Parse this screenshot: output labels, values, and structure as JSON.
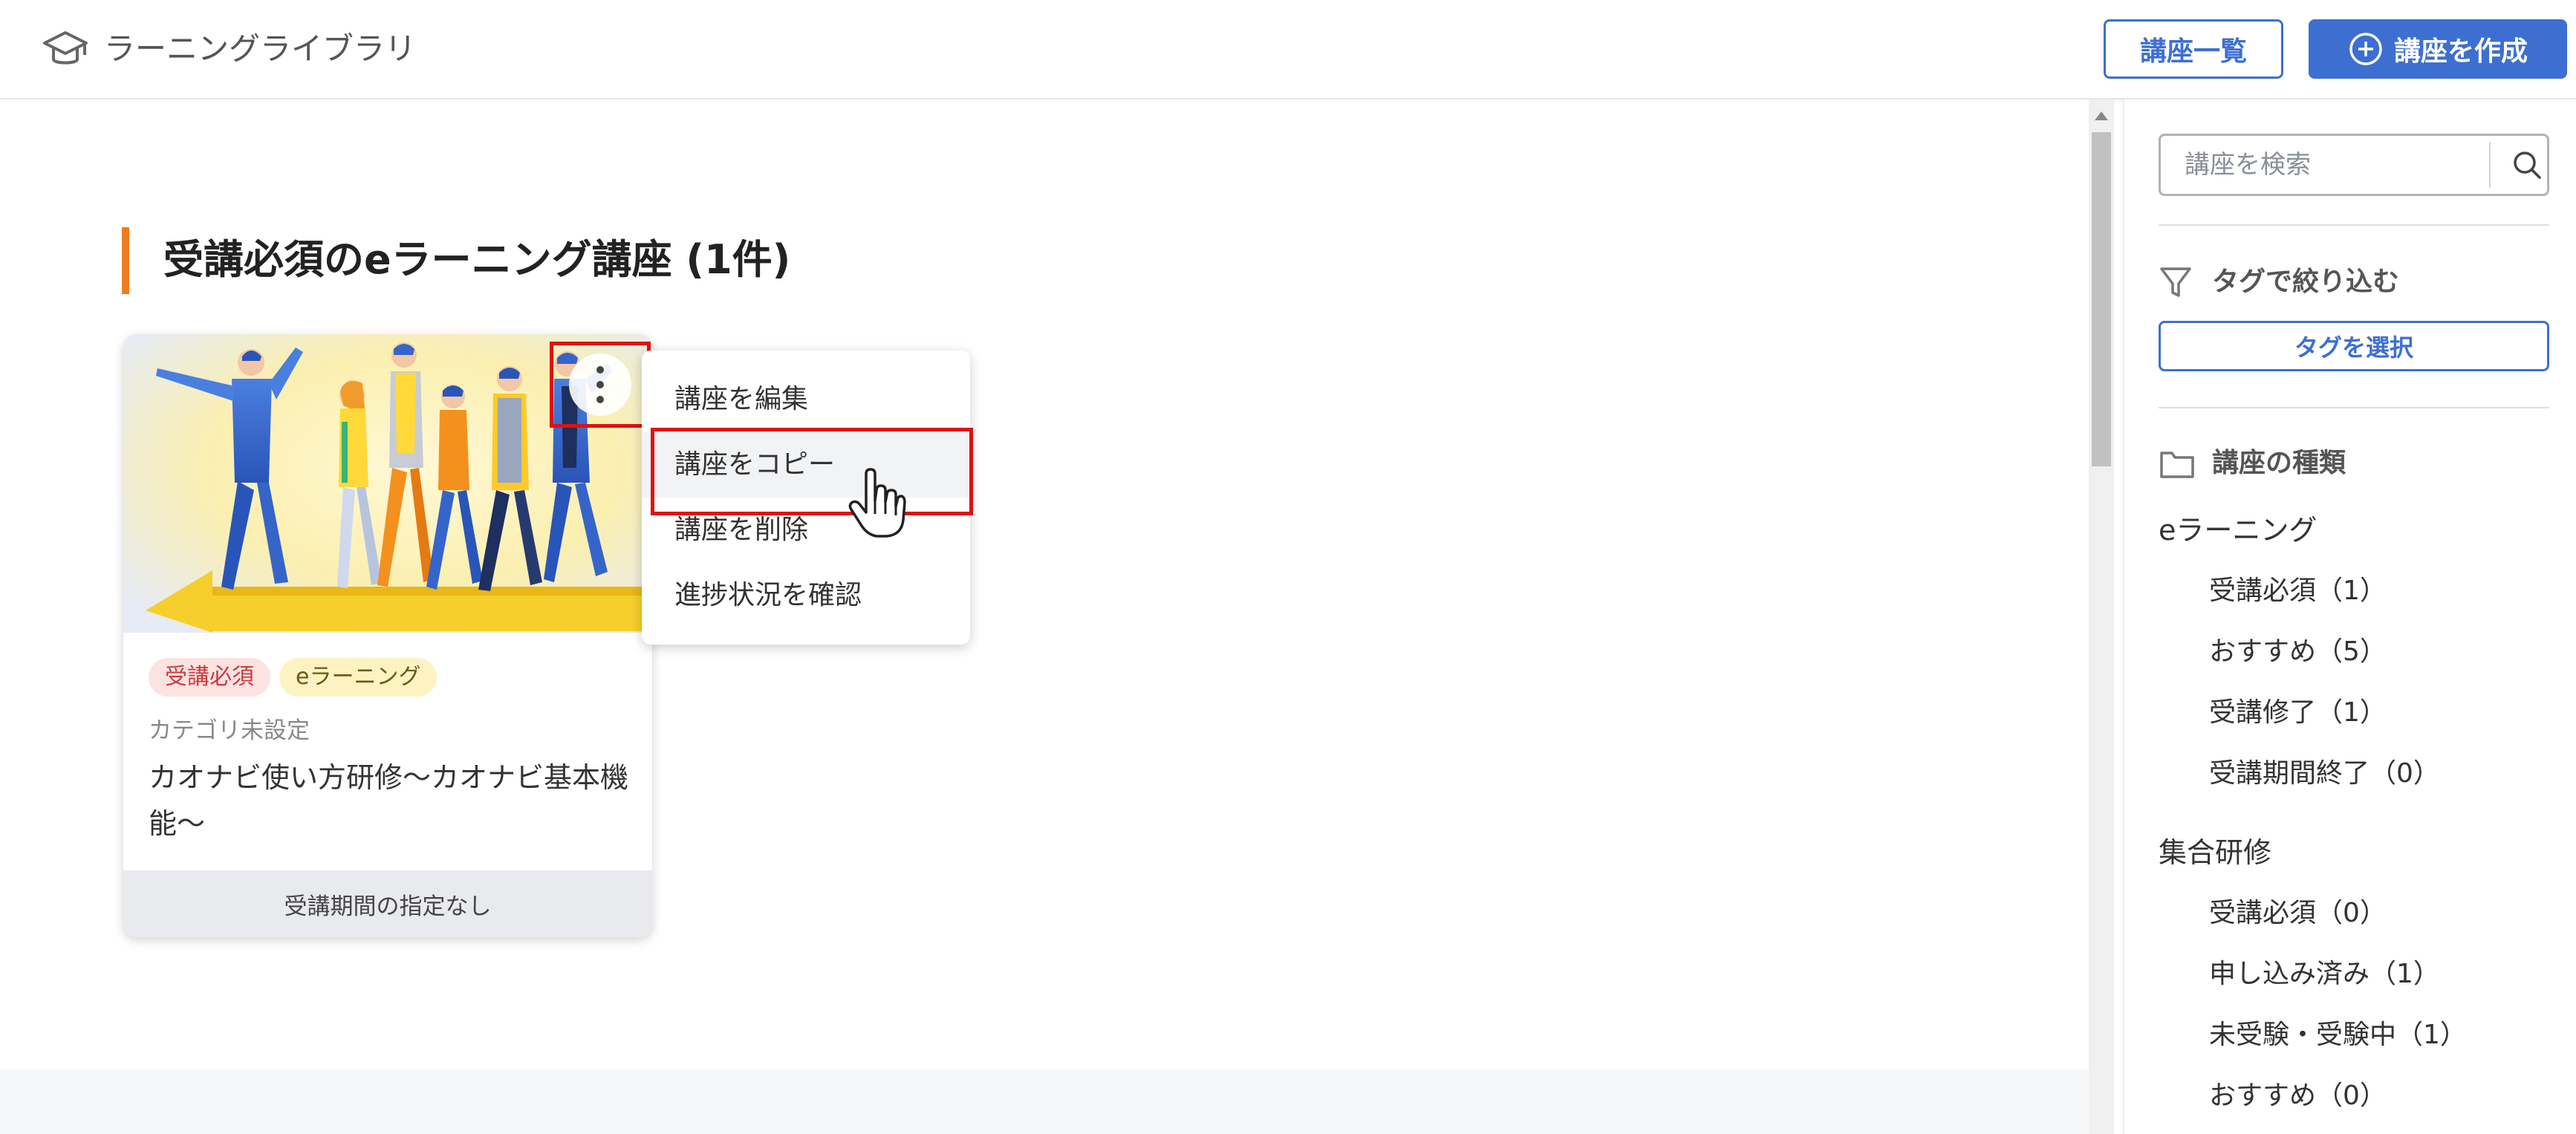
{
  "header": {
    "app_title": "ラーニングライブラリ",
    "course_list_label": "講座一覧",
    "create_course_label": "講座を作成"
  },
  "section": {
    "title": "受講必須のeラーニング講座 (1件)"
  },
  "card": {
    "tags": [
      "受講必須",
      "eラーニング"
    ],
    "category": "カテゴリ未設定",
    "title": "カオナビ使い方研修～カオナビ基本機能～",
    "period": "受講期間の指定なし"
  },
  "menu": {
    "items": [
      "講座を編集",
      "講座をコピー",
      "講座を削除",
      "進捗状況を確認"
    ]
  },
  "sidebar": {
    "search_placeholder": "講座を検索",
    "tag_filter_label": "タグで絞り込む",
    "tag_select_label": "タグを選択",
    "types_label": "講座の種類",
    "groups": [
      {
        "label": "eラーニング",
        "items": [
          "受講必須（1）",
          "おすすめ（5）",
          "受講修了（1）",
          "受講期間終了（0）"
        ]
      },
      {
        "label": "集合研修",
        "items": [
          "受講必須（0）",
          "申し込み済み（1）",
          "未受験・受験中（1）",
          "おすすめ（0）"
        ]
      }
    ]
  },
  "colors": {
    "primary": "#3d6fd1",
    "accent_orange": "#ee7d22",
    "highlight_red": "#e01010"
  }
}
